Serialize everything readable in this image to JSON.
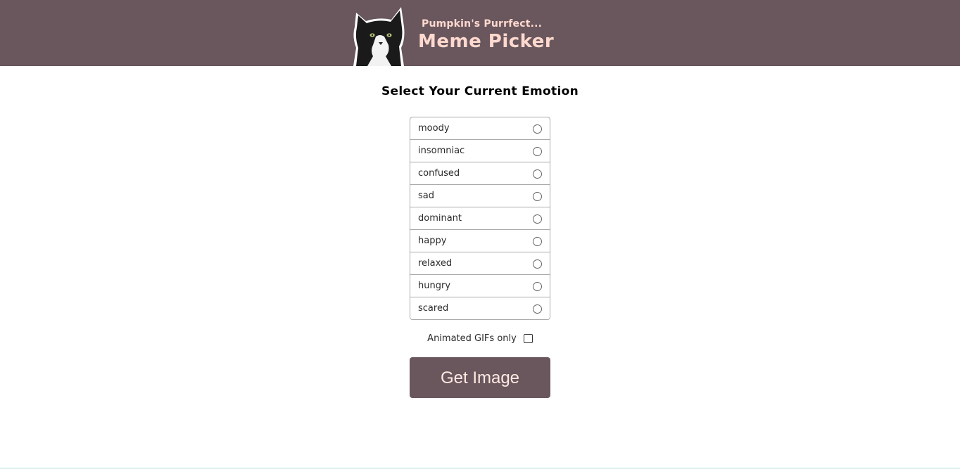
{
  "header": {
    "subtitle": "Pumpkin's Purrfect...",
    "title": "Meme Picker",
    "logo_icon": "cat-logo-icon",
    "bg_color": "#69575d",
    "text_color": "#ffd9cf"
  },
  "main": {
    "heading": "Select Your Current Emotion",
    "emotions": [
      {
        "label": "moody"
      },
      {
        "label": "insomniac"
      },
      {
        "label": "confused"
      },
      {
        "label": "sad"
      },
      {
        "label": "dominant"
      },
      {
        "label": "happy"
      },
      {
        "label": "relaxed"
      },
      {
        "label": "hungry"
      },
      {
        "label": "scared"
      }
    ],
    "gif_label": "Animated GIFs only",
    "button_label": "Get Image"
  }
}
